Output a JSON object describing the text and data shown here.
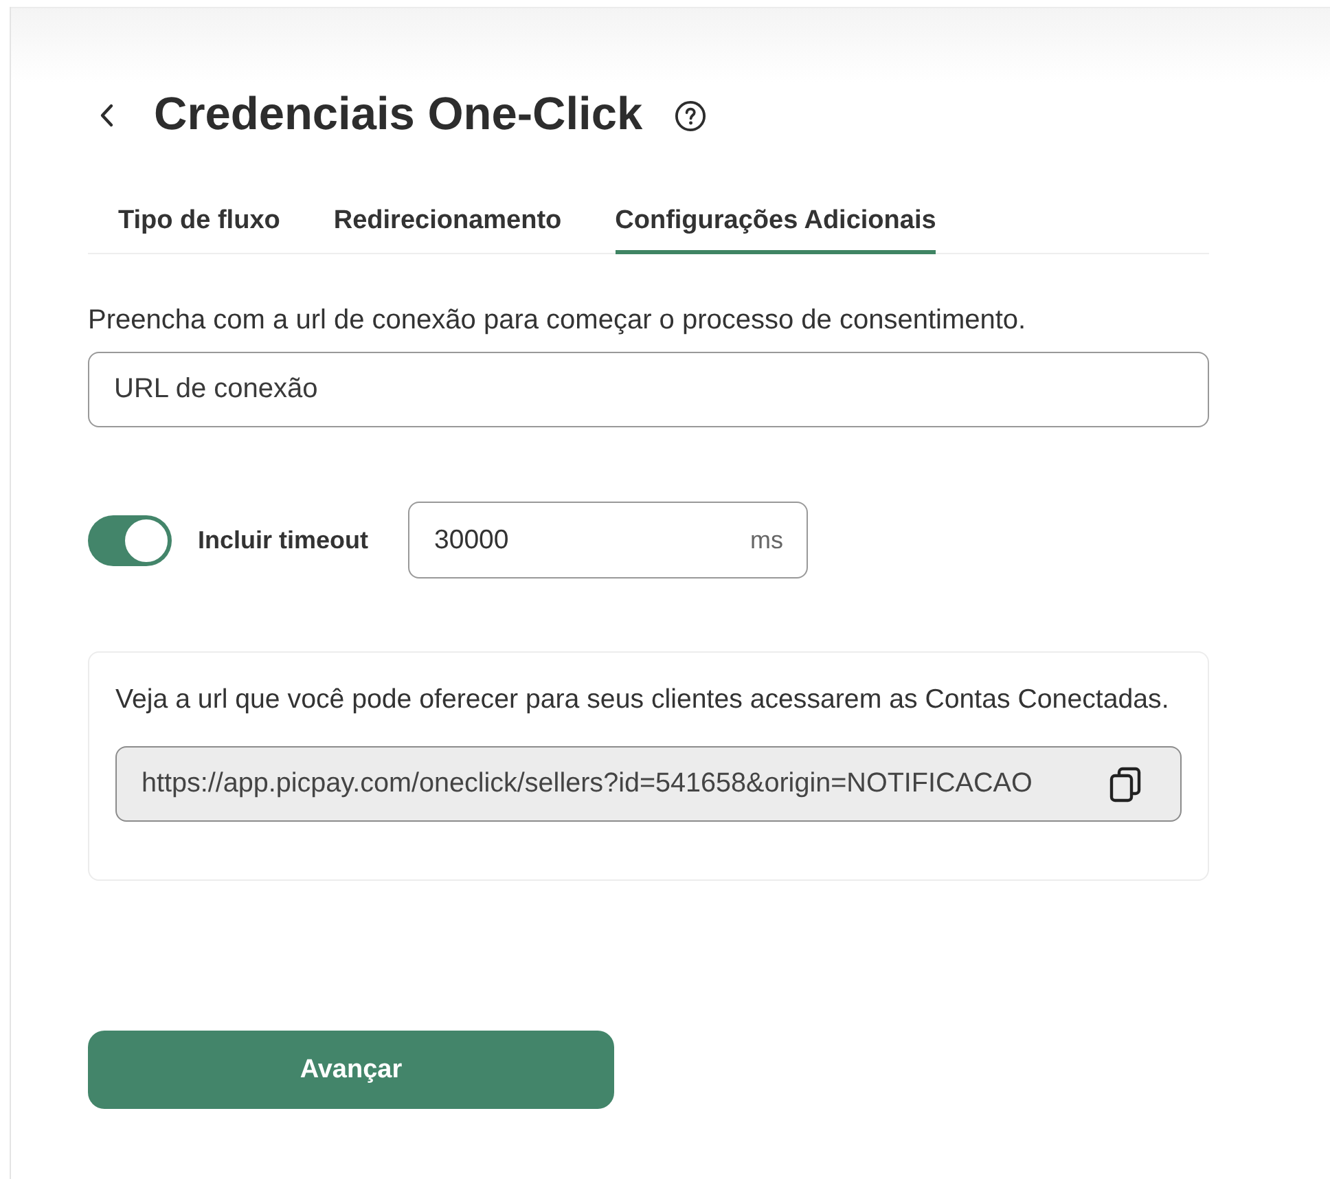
{
  "header": {
    "title": "Credenciais One-Click"
  },
  "tabs": [
    {
      "label": "Tipo de fluxo",
      "selected": false
    },
    {
      "label": "Redirecionamento",
      "selected": false
    },
    {
      "label": "Configurações Adicionais",
      "selected": true
    }
  ],
  "url_section": {
    "description": "Preencha com a url de conexão para começar o processo de consentimento.",
    "field": {
      "placeholder": "URL de conexão"
    }
  },
  "timeout": {
    "on": true,
    "label": "Incluir timeout",
    "value": "30000",
    "unit": "ms"
  },
  "share_card": {
    "description": "Veja a url que você pode oferecer para seus clientes acessarem as Contas Conectadas.",
    "url": "https://app.picpay.com/oneclick/sellers?id=541658&origin=NOTIFICACAO"
  },
  "buttons": [
    {
      "label": "Avançar"
    }
  ]
}
